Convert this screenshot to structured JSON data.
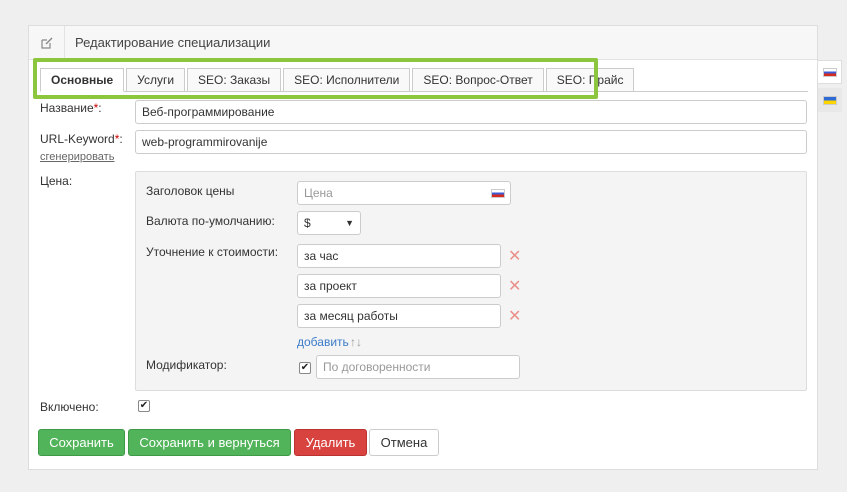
{
  "header": {
    "title": "Редактирование специализации",
    "icon": "edit-icon"
  },
  "tabs": [
    {
      "label": "Основные",
      "active": true
    },
    {
      "label": "Услуги"
    },
    {
      "label": "SEO: Заказы"
    },
    {
      "label": "SEO: Исполнители"
    },
    {
      "label": "SEO: Вопрос-Ответ"
    },
    {
      "label": "SEO: Прайс"
    }
  ],
  "form": {
    "name_label": "Название",
    "name_required": "*",
    "name_suffix": ":",
    "name_value": "Веб-программирование",
    "url_label": "URL-Keyword",
    "url_required": "*",
    "url_suffix": ":",
    "url_value": "web-programmirovanije",
    "generate_link": "сгенерировать",
    "price_label": "Цена:",
    "price": {
      "title_label": "Заголовок цены",
      "title_placeholder": "Цена",
      "currency_label": "Валюта по-умолчанию:",
      "currency_value": "$",
      "clarify_label": "Уточнение к стоимости:",
      "clarifications": [
        "за час",
        "за проект",
        "за месяц работы"
      ],
      "add_link": "добавить",
      "sort_icon": "↑↓",
      "modifier_label": "Модификатор:",
      "modifier_checked": true,
      "modifier_placeholder": "По договоренности"
    },
    "enabled_label": "Включено:",
    "enabled_checked": true
  },
  "buttons": {
    "save": "Сохранить",
    "save_return": "Сохранить и вернуться",
    "delete": "Удалить",
    "cancel": "Отмена"
  },
  "colors": {
    "green": "#52b45a",
    "red": "#d9433f",
    "tab_highlight": "#8cc63f",
    "link": "#3a7bc8"
  }
}
